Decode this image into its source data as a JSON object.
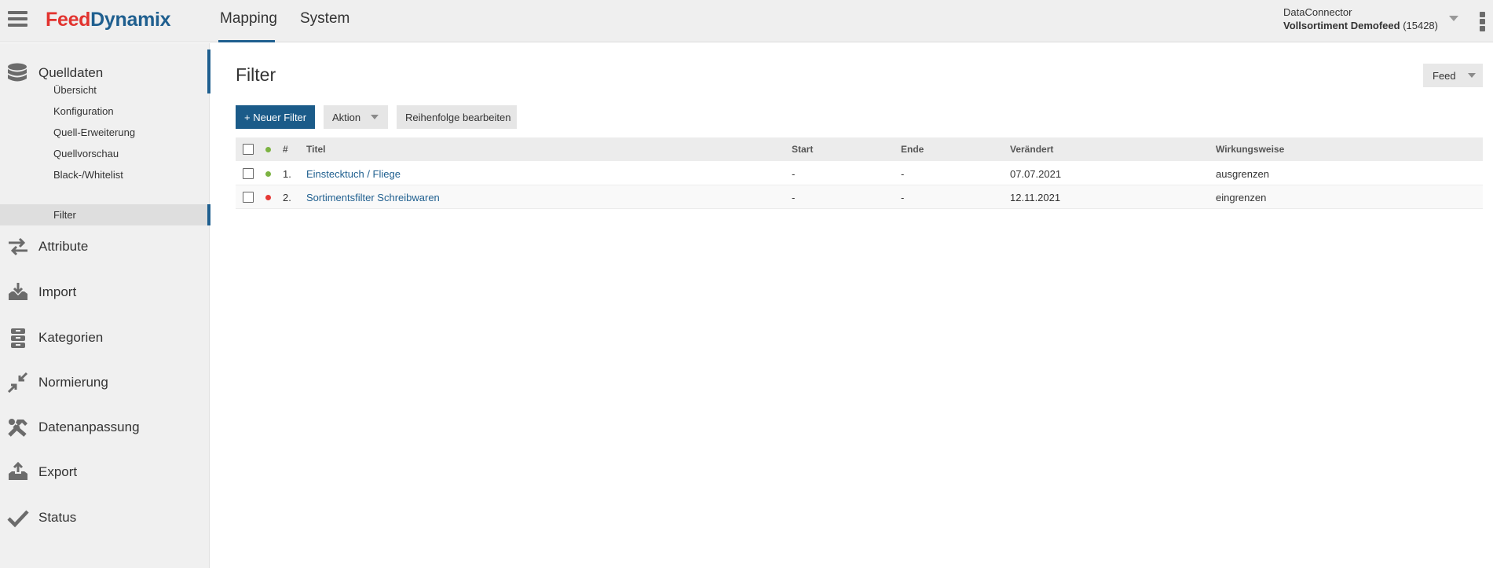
{
  "app": {
    "logo_part1": "Feed",
    "logo_part2": "Dynamix"
  },
  "nav": {
    "tabs": [
      {
        "label": "Mapping",
        "active": true
      },
      {
        "label": "System",
        "active": false
      }
    ]
  },
  "connector": {
    "label": "DataConnector",
    "feed_name": "Vollsortiment Demofeed",
    "feed_id": "(15428)"
  },
  "sidebar": {
    "main": [
      {
        "label": "Quelldaten",
        "icon": "database-icon"
      },
      {
        "label": "Attribute",
        "icon": "arrows-swap-icon"
      },
      {
        "label": "Import",
        "icon": "import-tray-icon"
      },
      {
        "label": "Kategorien",
        "icon": "categories-icon"
      },
      {
        "label": "Normierung",
        "icon": "compress-arrows-icon"
      },
      {
        "label": "Datenanpassung",
        "icon": "tools-icon"
      },
      {
        "label": "Export",
        "icon": "export-tray-icon"
      },
      {
        "label": "Status",
        "icon": "check-icon"
      }
    ],
    "sub": [
      {
        "label": "Übersicht"
      },
      {
        "label": "Konfiguration"
      },
      {
        "label": "Quell-Erweiterung"
      },
      {
        "label": "Quellvorschau"
      },
      {
        "label": "Black-/Whitelist"
      },
      {
        "label": "Filter"
      }
    ]
  },
  "page": {
    "title": "Filter",
    "feed_select": "Feed"
  },
  "toolbar": {
    "new_filter": "+ Neuer Filter",
    "action": "Aktion",
    "reorder": "Reihenfolge bearbeiten"
  },
  "table": {
    "headers": {
      "num": "#",
      "title": "Titel",
      "start": "Start",
      "end": "Ende",
      "changed": "Verändert",
      "mode": "Wirkungsweise"
    },
    "rows": [
      {
        "num": "1.",
        "title": "Einstecktuch / Fliege",
        "start": "-",
        "end": "-",
        "changed": "07.07.2021",
        "mode": "ausgrenzen",
        "status_color": "#7cb342"
      },
      {
        "num": "2.",
        "title": "Sortimentsfilter Schreibwaren",
        "start": "-",
        "end": "-",
        "changed": "12.11.2021",
        "mode": "eingrenzen",
        "status_color": "#e53935"
      }
    ]
  },
  "colors": {
    "accent": "#1f5f8f",
    "brand_red": "#e2332f",
    "status_active": "#7cb342",
    "status_inactive": "#e53935"
  }
}
